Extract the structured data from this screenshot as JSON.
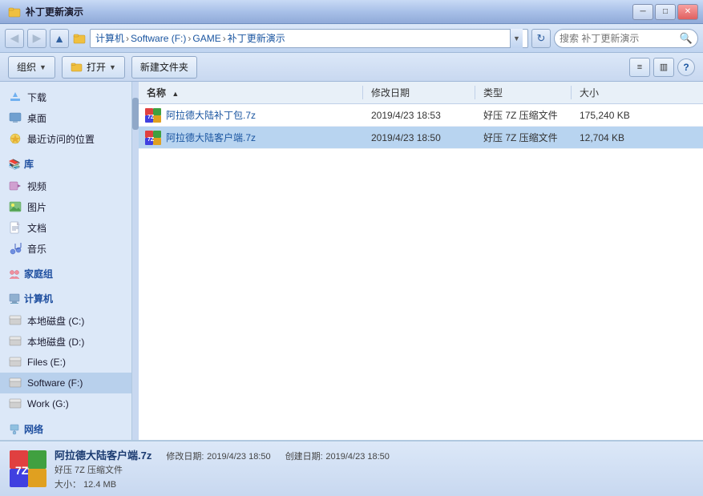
{
  "window": {
    "title": "补丁更新演示",
    "controls": {
      "minimize": "─",
      "maximize": "□",
      "close": "✕"
    }
  },
  "nav": {
    "back_disabled": true,
    "forward_disabled": true,
    "breadcrumbs": [
      "计算机",
      "Software (F:)",
      "GAME",
      "补丁更新演示"
    ],
    "search_placeholder": "搜索 补丁更新演示",
    "refresh_label": "↻"
  },
  "toolbar": {
    "organize_label": "组织",
    "open_label": "打开",
    "new_folder_label": "新建文件夹",
    "view_label": "≡",
    "pane_label": "▥",
    "help_label": "?"
  },
  "sidebar": {
    "favorites": [
      {
        "id": "download",
        "label": "下载",
        "icon": "⬇"
      },
      {
        "id": "desktop",
        "label": "桌面",
        "icon": "🖥"
      },
      {
        "id": "recent",
        "label": "最近访问的位置",
        "icon": "⭐"
      }
    ],
    "library_section": "库",
    "libraries": [
      {
        "id": "video",
        "label": "视频",
        "icon": "🎬"
      },
      {
        "id": "picture",
        "label": "图片",
        "icon": "🖼"
      },
      {
        "id": "document",
        "label": "文档",
        "icon": "📄"
      },
      {
        "id": "music",
        "label": "音乐",
        "icon": "🎵"
      }
    ],
    "homegroup_section": "家庭组",
    "computer_section": "计算机",
    "drives": [
      {
        "id": "c",
        "label": "本地磁盘 (C:)",
        "icon": "💾"
      },
      {
        "id": "d",
        "label": "本地磁盘 (D:)",
        "icon": "💾"
      },
      {
        "id": "e",
        "label": "Files (E:)",
        "icon": "💾"
      },
      {
        "id": "f",
        "label": "Software (F:)",
        "icon": "💾",
        "selected": true
      },
      {
        "id": "g",
        "label": "Work (G:)",
        "icon": "💾"
      }
    ],
    "network_section": "网络"
  },
  "file_list": {
    "headers": {
      "name": "名称",
      "date": "修改日期",
      "type": "类型",
      "size": "大小"
    },
    "files": [
      {
        "id": "file1",
        "name": "阿拉德大陆补丁包.7z",
        "date": "2019/4/23 18:53",
        "type": "好压 7Z 压缩文件",
        "size": "175,240 KB",
        "selected": false
      },
      {
        "id": "file2",
        "name": "阿拉德大陆客户端.7z",
        "date": "2019/4/23 18:50",
        "type": "好压 7Z 压缩文件",
        "size": "12,704 KB",
        "selected": true
      }
    ]
  },
  "status": {
    "filename": "阿拉德大陆客户端.7z",
    "modified_label": "修改日期:",
    "modified_value": "2019/4/23 18:50",
    "created_label": "创建日期:",
    "created_value": "2019/4/23 18:50",
    "filetype": "好压 7Z 压缩文件",
    "size_label": "大小：",
    "size_value": "12.4 MB"
  },
  "colors": {
    "accent": "#3060a0",
    "selected_bg": "#90b8e0",
    "header_bg": "#dce8f8"
  }
}
